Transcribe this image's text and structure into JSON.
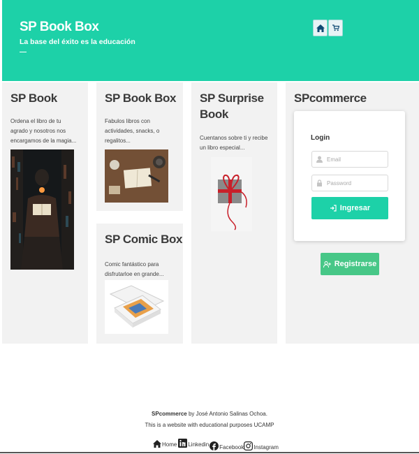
{
  "header": {
    "title": "SP Book Box",
    "subtitle": "La base del éxito es la educación",
    "dash": "—",
    "home_icon": "home-icon",
    "cart_icon": "cart-icon",
    "bg_color": "#1dd1a8"
  },
  "cards": {
    "sp_book": {
      "title": "SP Book",
      "text": "Ordena el libro de tu agrado y nosotros nos encargamos de la magia..."
    },
    "sp_book_box": {
      "title": "SP Book Box",
      "text": "Fabulos libros con actividades, snacks, o regalitos..."
    },
    "sp_comic_box": {
      "title": "SP Comic Box",
      "text": "Comic fantástico para disfrutarloe en grande..."
    },
    "sp_surprise": {
      "title": "SP Surprise Book",
      "text": "Cuentanos sobre ti y recibe un libro especial..."
    },
    "spcommerce": {
      "title": "SPcommerce"
    }
  },
  "login": {
    "label": "Login",
    "email_placeholder": "Email",
    "password_placeholder": "Password",
    "submit_label": "Ingresar",
    "register_label": "Registrarse"
  },
  "footer": {
    "brand": "SPcommerce",
    "credit": " by José Antonio Salinas Ochoa.",
    "purpose": "This is a website with educational purposes UCAMP",
    "links": [
      {
        "label": "Home",
        "icon": "home-icon"
      },
      {
        "label": "Linkedin",
        "icon": "linkedin-icon"
      },
      {
        "label": "Facebook",
        "icon": "facebook-icon"
      },
      {
        "label": "Instagram",
        "icon": "instagram-icon"
      }
    ]
  },
  "colors": {
    "accent": "#1dd1a8",
    "register": "#47c787",
    "card_bg": "#f2f2f2"
  }
}
